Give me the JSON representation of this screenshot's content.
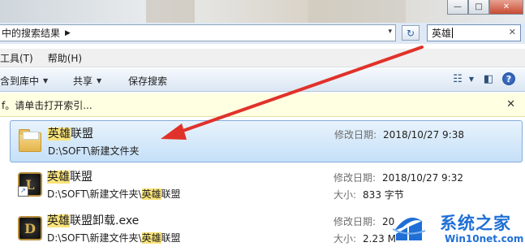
{
  "window": {
    "buttons": {
      "minimize": "—",
      "maximize": "□",
      "close": "✕"
    }
  },
  "address": {
    "breadcrumb": "中的搜索结果",
    "separator": "▶",
    "dropdown": "▾"
  },
  "search": {
    "value": "英雄",
    "clear": "✕"
  },
  "menu": {
    "tools": "工具(T)",
    "help": "帮助(H)"
  },
  "toolbar": {
    "include_library": "含到库中",
    "share": "共享",
    "save_search": "保存搜索",
    "dropdown_arrow": "▼"
  },
  "infobar": {
    "text": "f。请单击打开索引...",
    "close": "✕"
  },
  "results": [
    {
      "name_highlight": "英雄",
      "name_rest": "联盟",
      "path_prefix": "D:\\SOFT\\新建文件夹",
      "path_highlight": "",
      "path_rest": "",
      "meta1_label": "修改日期:",
      "meta1_value": "2018/10/27 9:38",
      "meta2_label": "",
      "meta2_value": "",
      "icon": "folder-icon",
      "selected": true
    },
    {
      "name_highlight": "英雄",
      "name_rest": "联盟",
      "path_prefix": "D:\\SOFT\\新建文件夹\\",
      "path_highlight": "英雄",
      "path_rest": "联盟",
      "meta1_label": "修改日期:",
      "meta1_value": "2018/10/27 9:32",
      "meta2_label": "大小:",
      "meta2_value": "833 字节",
      "icon": "shortcut-icon",
      "selected": false
    },
    {
      "name_highlight": "英雄",
      "name_rest": "联盟卸载.exe",
      "path_prefix": "D:\\SOFT\\新建文件夹\\",
      "path_highlight": "英雄",
      "path_rest": "联盟",
      "meta1_label": "修改日期:",
      "meta1_value": "20",
      "meta2_label": "大小:",
      "meta2_value": "2.23 M",
      "icon": "exe-icon",
      "selected": false
    }
  ],
  "watermark": {
    "title": "系统之家",
    "url": "Win10net.com"
  },
  "colors": {
    "highlight": "#f9e37a",
    "selection": "#c5e0f8",
    "annotation": "#e0322a",
    "watermark": "#1f6fd6"
  }
}
